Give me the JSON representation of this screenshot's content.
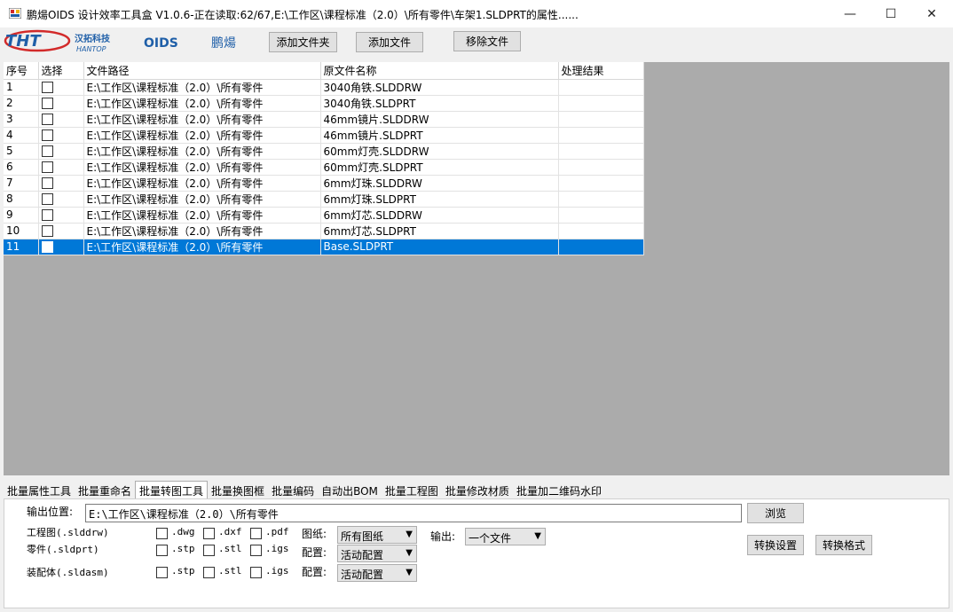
{
  "window": {
    "title": "鹏煬OIDS 设计效率工具盒 V1.0.6-正在读取:62/67,E:\\工作区\\课程标准（2.0）\\所有零件\\车架1.SLDPRT的属性......",
    "minimize": "—",
    "maximize": "☐",
    "close": "✕"
  },
  "toolbar": {
    "logo_tht": "THT",
    "logo_tht_cn": "汉拓科技",
    "logo_tht_en": "HANTOP",
    "logo_oids": "OIDS",
    "logo_oids_cn": "鹏煬",
    "add_folder": "添加文件夹",
    "add_file": "添加文件",
    "remove_file": "移除文件"
  },
  "grid": {
    "headers": [
      "序号",
      "选择",
      "文件路径",
      "原文件名称",
      "处理结果"
    ],
    "rows": [
      {
        "no": "1",
        "path": "E:\\工作区\\课程标准（2.0）\\所有零件",
        "name": "3040角铁.SLDDRW",
        "result": ""
      },
      {
        "no": "2",
        "path": "E:\\工作区\\课程标准（2.0）\\所有零件",
        "name": "3040角铁.SLDPRT",
        "result": ""
      },
      {
        "no": "3",
        "path": "E:\\工作区\\课程标准（2.0）\\所有零件",
        "name": "46mm镜片.SLDDRW",
        "result": ""
      },
      {
        "no": "4",
        "path": "E:\\工作区\\课程标准（2.0）\\所有零件",
        "name": "46mm镜片.SLDPRT",
        "result": ""
      },
      {
        "no": "5",
        "path": "E:\\工作区\\课程标准（2.0）\\所有零件",
        "name": "60mm灯壳.SLDDRW",
        "result": ""
      },
      {
        "no": "6",
        "path": "E:\\工作区\\课程标准（2.0）\\所有零件",
        "name": "60mm灯壳.SLDPRT",
        "result": ""
      },
      {
        "no": "7",
        "path": "E:\\工作区\\课程标准（2.0）\\所有零件",
        "name": "6mm灯珠.SLDDRW",
        "result": ""
      },
      {
        "no": "8",
        "path": "E:\\工作区\\课程标准（2.0）\\所有零件",
        "name": "6mm灯珠.SLDPRT",
        "result": ""
      },
      {
        "no": "9",
        "path": "E:\\工作区\\课程标准（2.0）\\所有零件",
        "name": "6mm灯芯.SLDDRW",
        "result": ""
      },
      {
        "no": "10",
        "path": "E:\\工作区\\课程标准（2.0）\\所有零件",
        "name": "6mm灯芯.SLDPRT",
        "result": ""
      },
      {
        "no": "11",
        "path": "E:\\工作区\\课程标准（2.0）\\所有零件",
        "name": "Base.SLDPRT",
        "result": "",
        "selected": true
      }
    ]
  },
  "tabs": [
    "批量属性工具",
    "批量重命名",
    "批量转图工具",
    "批量换图框",
    "批量编码",
    "自动出BOM",
    "批量工程图",
    "批量修改材质",
    "批量加二维码水印"
  ],
  "active_tab": 2,
  "panel": {
    "output_label": "输出位置:",
    "output_value": "E:\\工作区\\课程标准（2.0）\\所有零件",
    "browse": "浏览",
    "drawing_label": "工程图(.slddrw)",
    "part_label": "零件(.sldprt)",
    "assembly_label": "装配体(.sldasm)",
    "opt_dwg": ".dwg",
    "opt_dxf": ".dxf",
    "opt_pdf": ".pdf",
    "opt_stp": ".stp",
    "opt_stl": ".stl",
    "opt_igs": ".igs",
    "sheet_label": "图纸:",
    "sheet_value": "所有图纸",
    "config_label": "配置:",
    "config_value": "活动配置",
    "output_mode_label": "输出:",
    "output_mode_value": "一个文件",
    "convert_settings": "转换设置",
    "convert_format": "转换格式"
  },
  "colors": {
    "selection": "#0078d7",
    "grid_background": "#ababab",
    "logo_red": "#d22a2a",
    "logo_blue": "#1f5fa8"
  }
}
